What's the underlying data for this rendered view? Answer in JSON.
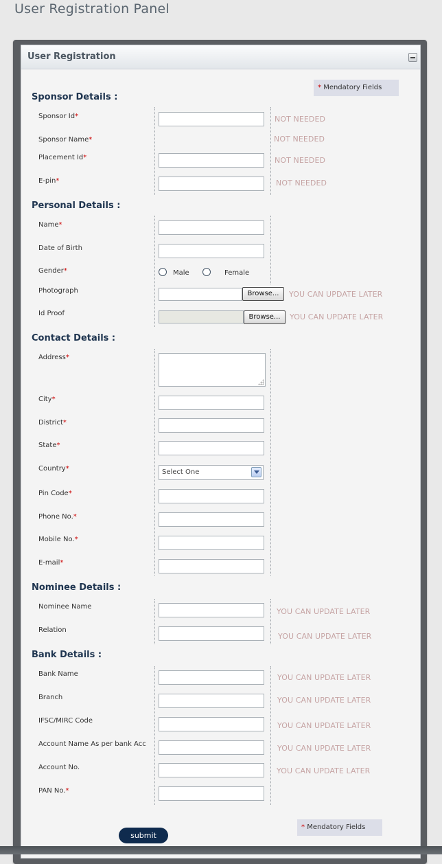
{
  "page_title": "User Registration Panel",
  "panel_title": "User Registration",
  "mandatory_note": "Mendatory Fields",
  "required_mark": "*",
  "browse_label": "Browse...",
  "submit_label": "submit",
  "hints": {
    "not_needed": "NOT NEEDED",
    "update_later": "YOU CAN UPDATE LATER"
  },
  "sections": {
    "sponsor": "Sponsor Details :",
    "personal": "Personal Details :",
    "contact": "Contact Details :",
    "nominee": "Nominee Details :",
    "bank": "Bank Details :"
  },
  "fields": {
    "sponsor_id": "Sponsor Id",
    "sponsor_name": "Sponsor Name",
    "placement_id": "Placement Id",
    "epin": "E-pin",
    "name": "Name",
    "dob": "Date of Birth",
    "gender": "Gender",
    "photograph": "Photograph",
    "id_proof": "Id Proof",
    "address": "Address",
    "city": "City",
    "district": "District",
    "state": "State",
    "country": "Country",
    "pin_code": "Pin Code",
    "phone": "Phone No.",
    "mobile": "Mobile No.",
    "email": "E-mail",
    "nominee_name": "Nominee Name",
    "relation": "Relation",
    "bank_name": "Bank Name",
    "branch": "Branch",
    "ifsc": "IFSC/MIRC Code",
    "account_name": "Account Name As per bank Acc",
    "account_no": "Account No.",
    "pan": "PAN No."
  },
  "gender_options": {
    "male": "Male",
    "female": "Female"
  },
  "country_select": {
    "selected": "Select One"
  },
  "colors": {
    "required": "#cc0000",
    "hint": "#c6a4a4",
    "section_heading": "#1f3550",
    "submit_bg": "#0f2b4e"
  }
}
